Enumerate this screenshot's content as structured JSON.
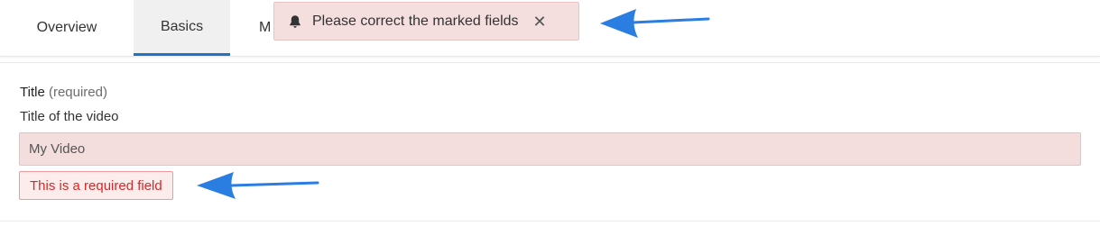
{
  "tabs": [
    {
      "label": "Overview"
    },
    {
      "label": "Basics"
    },
    {
      "label": "M"
    }
  ],
  "alert": {
    "message": "Please correct the marked fields",
    "icon": "bell-icon",
    "close_glyph": "✕"
  },
  "form": {
    "title_field": {
      "label": "Title",
      "required_note": "(required)",
      "help": "Title of the video",
      "value": "My Video",
      "error": "This is a required field"
    }
  },
  "colors": {
    "accent": "#1f73c7",
    "alert_bg": "#f5dede",
    "error_text": "#d42a2a",
    "annotation_arrow": "#2a7de1"
  }
}
